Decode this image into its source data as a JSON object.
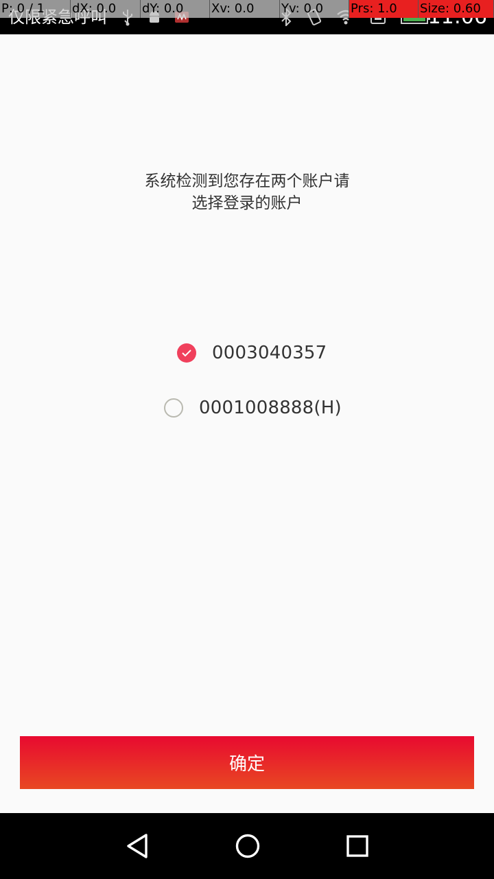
{
  "status_bar": {
    "notification_text": "仅限紧急呼叫",
    "clock": "11:06",
    "icons": [
      "usb-icon",
      "android-icon",
      "app-icon",
      "bluetooth-icon",
      "vibrate-icon",
      "wifi-icon",
      "sim-icon",
      "battery-icon"
    ]
  },
  "debug_overlay": {
    "cells": [
      "P: 0 / 1",
      "dX: 0.0",
      "dY: 0.0",
      "Xv: 0.0",
      "Yv: 0.0",
      "Prs: 1.0",
      "Size: 0.60"
    ]
  },
  "prompt": {
    "line1": "系统检测到您存在两个账户请",
    "line2": "选择登录的账户"
  },
  "accounts": [
    {
      "number": "0003040357",
      "selected": true
    },
    {
      "number": "0001008888(H)",
      "selected": false
    }
  ],
  "confirm_label": "确定",
  "colors": {
    "accent": "#f0405c",
    "button_top": "#e80a30",
    "button_bottom": "#e84822"
  }
}
